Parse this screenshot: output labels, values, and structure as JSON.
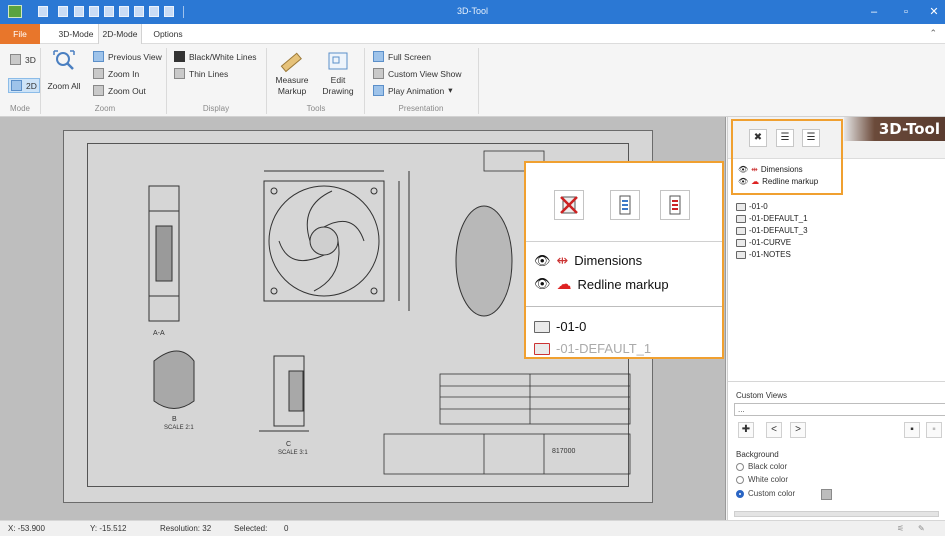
{
  "window": {
    "title": "3D-Tool"
  },
  "ribbon": {
    "tabs": [
      "File",
      "3D-Mode",
      "2D-Mode",
      "Options"
    ],
    "active_tab": "2D-Mode",
    "mode": {
      "label_3d": "3D",
      "label_2d": "2D",
      "group": "Mode"
    },
    "zoom": {
      "zoom_all": "Zoom All",
      "previous_view": "Previous View",
      "zoom_in": "Zoom In",
      "zoom_out": "Zoom Out",
      "group": "Zoom"
    },
    "display": {
      "bw_lines": "Black/White Lines",
      "thin_lines": "Thin Lines",
      "group": "Display"
    },
    "tools": {
      "measure_markup": "Measure Markup",
      "edit_drawing": "Edit Drawing",
      "group": "Tools"
    },
    "presentation": {
      "full_screen": "Full Screen",
      "custom_view_show": "Custom View Show",
      "play_animation": "Play Animation",
      "group": "Presentation"
    }
  },
  "right_panel": {
    "logo": "3D-Tool",
    "layers": [
      "Dimensions",
      "Redline markup"
    ],
    "tree": [
      "-01-0",
      "-01-DEFAULT_1",
      "-01-DEFAULT_3",
      "-01-CURVE",
      "-01-NOTES"
    ],
    "custom_views_label": "Custom Views",
    "custom_views_value": "...",
    "background_label": "Background",
    "background_options": [
      "Black color",
      "White color",
      "Custom color"
    ],
    "background_selected": "Custom color"
  },
  "zoom_callout": {
    "layers": [
      "Dimensions",
      "Redline markup"
    ],
    "tree": [
      "-01-0",
      "-01-DEFAULT_1"
    ]
  },
  "status": {
    "x": "X: -53.900",
    "y": "Y: -15.512",
    "resolution": "Resolution: 32",
    "selected_label": "Selected:",
    "selected_value": "0"
  },
  "drawing": {
    "section_label": "A-A",
    "detail_b": "B",
    "scale_b": "SCALE 2:1",
    "detail_c": "C",
    "scale_c": "SCALE 3:1",
    "part_number": "817000"
  },
  "colors": {
    "titlebar": "#2b78d4",
    "file_tab": "#e8762b",
    "highlight": "#f0a030"
  }
}
